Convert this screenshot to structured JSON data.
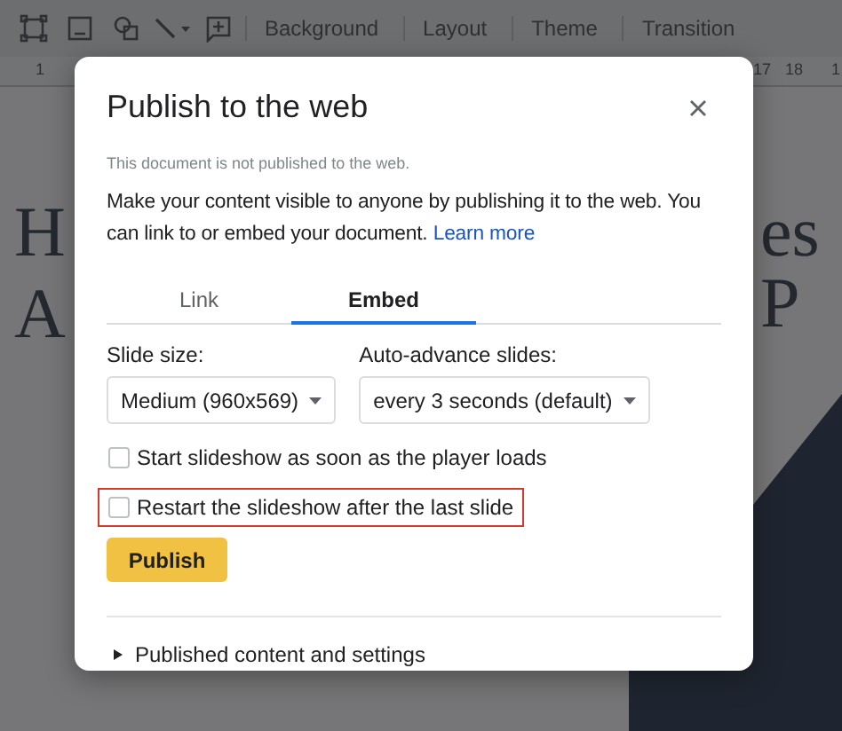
{
  "toolbar": {
    "items": [
      {
        "kind": "icon"
      },
      {
        "kind": "icon"
      },
      {
        "kind": "icon"
      },
      {
        "kind": "icon"
      },
      {
        "kind": "icon"
      },
      {
        "kind": "text",
        "label": "Background"
      },
      {
        "kind": "text",
        "label": "Layout"
      },
      {
        "kind": "text",
        "label": "Theme"
      },
      {
        "kind": "text",
        "label": "Transition"
      }
    ]
  },
  "ruler": {
    "labels": [
      "1",
      "17",
      "18",
      "1"
    ]
  },
  "slide": {
    "left_text": [
      "H",
      "A"
    ],
    "right_text": "es P"
  },
  "dialog": {
    "title": "Publish to the web",
    "status": "This document is not published to the web.",
    "description": "Make your content visible to anyone by publishing it to the web. You can link to or embed your document.",
    "link": "Learn more",
    "tabs": [
      {
        "label": "Link",
        "selected": false
      },
      {
        "label": "Embed",
        "selected": true
      }
    ],
    "selects": [
      {
        "label": "Slide size:",
        "value": "Medium (960x569)"
      },
      {
        "label": "Auto-advance slides:",
        "value": "every 3 seconds (default)"
      }
    ],
    "options": [
      {
        "label": "Start slideshow as soon as the player loads",
        "checked": false,
        "highlighted": false
      },
      {
        "label": "Restart the slideshow after the last slide",
        "checked": false,
        "highlighted": true
      }
    ],
    "publish_button": "Publish",
    "disclosure": {
      "label": "Published content and settings",
      "expanded": false
    }
  }
}
